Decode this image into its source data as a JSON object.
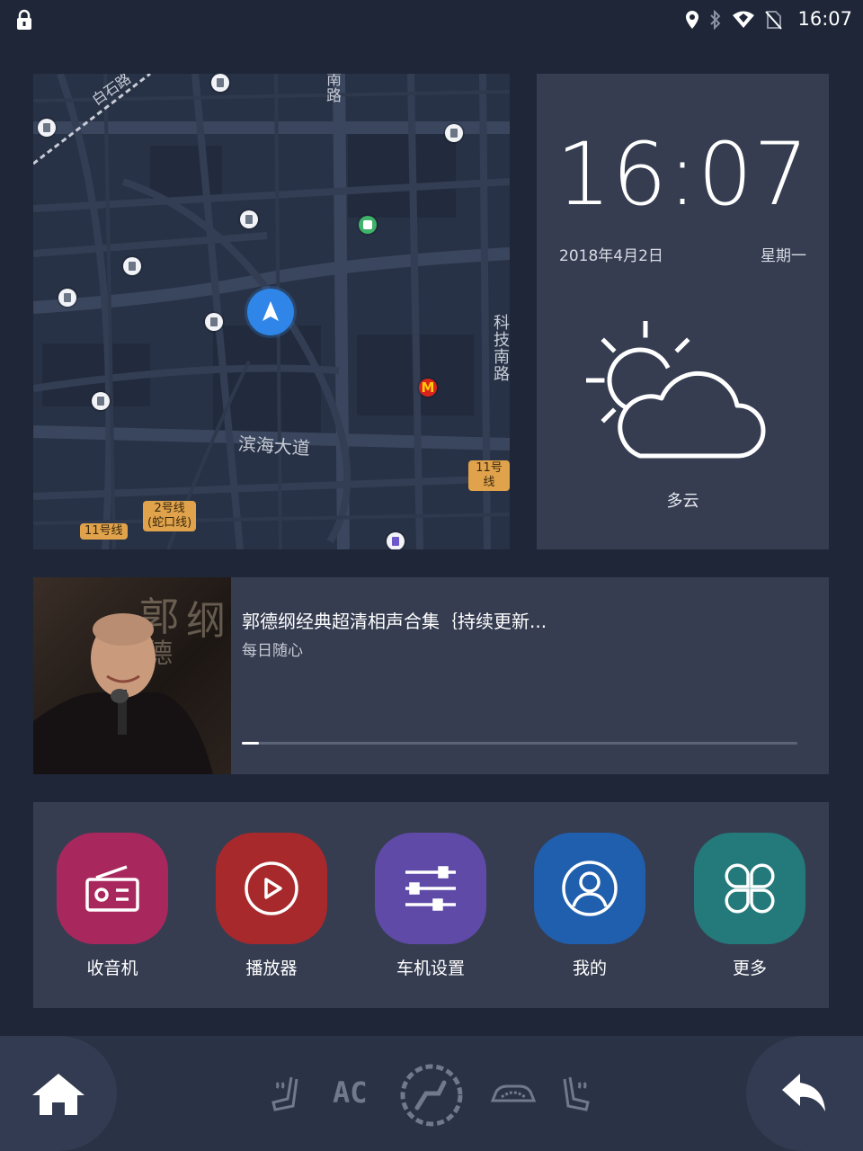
{
  "status_bar": {
    "time": "16:07",
    "icons": [
      "lock-icon",
      "location-icon",
      "bluetooth-icon",
      "wifi-icon",
      "no-sim-icon"
    ]
  },
  "map": {
    "labels": {
      "road_baishi": "白石路",
      "road_nan": "南路",
      "road_binhai": "滨海大道",
      "road_keji": "科技南路"
    },
    "badges": {
      "line11_right": "11号线",
      "line2": "2号线\n(蛇口线)",
      "line11_left": "11号线"
    }
  },
  "clock": {
    "time": "16:07",
    "date": "2018年4月2日",
    "weekday": "星期一",
    "weather": "多云",
    "weather_icon": "partly-cloudy-icon"
  },
  "media": {
    "title": "郭德纲经典超清相声合集｛持续更新...",
    "subtitle": "每日随心",
    "progress": 0.03
  },
  "apps": [
    {
      "label": "收音机",
      "icon": "radio-icon",
      "color": "#a8285e"
    },
    {
      "label": "播放器",
      "icon": "play-circle-icon",
      "color": "#a8292b"
    },
    {
      "label": "车机设置",
      "icon": "sliders-icon",
      "color": "#5f4aa8"
    },
    {
      "label": "我的",
      "icon": "user-icon",
      "color": "#1f5fae"
    },
    {
      "label": "更多",
      "icon": "apps-grid-icon",
      "color": "#24797a"
    }
  ],
  "bottom_bar": {
    "ac_label": "AC",
    "icons": [
      "home-icon",
      "seat-heat-left-icon",
      "ac-icon",
      "fan-icon",
      "car-recirculation-icon",
      "seat-heat-right-icon",
      "back-icon"
    ]
  },
  "colors": {
    "background": "#1e2638",
    "card": "#363d51",
    "map_bg": "#283246",
    "nav_blue": "#2f86e8",
    "metro_badge": "#e0a24a"
  }
}
